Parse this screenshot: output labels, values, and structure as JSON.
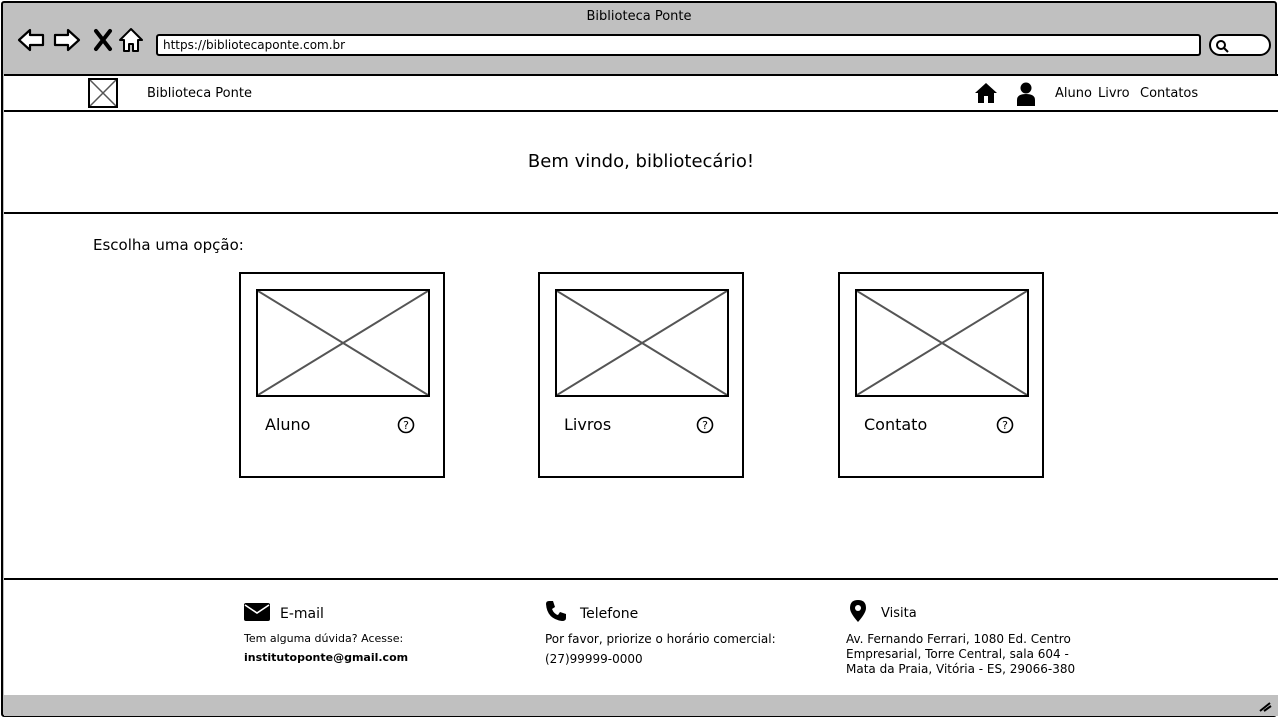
{
  "window": {
    "title": "Biblioteca Ponte"
  },
  "browser": {
    "url": "https://bibliotecaponte.com.br",
    "nav_icons": [
      "back-arrow-icon",
      "forward-arrow-icon",
      "stop-x-icon",
      "home-outline-icon"
    ],
    "search_icon": "magnifier-icon"
  },
  "header": {
    "brand": "Biblioteca Ponte",
    "icons": [
      "home-icon",
      "user-icon"
    ],
    "links": [
      "Aluno",
      "Livro",
      "Contatos"
    ]
  },
  "hero": {
    "title": "Bem vindo, bibliotecário!"
  },
  "options": {
    "prompt": "Escolha uma opção:",
    "cards": [
      {
        "label": "Aluno"
      },
      {
        "label": "Livros"
      },
      {
        "label": "Contato"
      }
    ]
  },
  "footer": {
    "email": {
      "title": "E-mail",
      "line1": "Tem alguma dúvida? Acesse:",
      "line2": "institutoponte@gmail.com"
    },
    "phone": {
      "title": "Telefone",
      "line1": "Por favor, priorize o horário comercial:",
      "line2": "(27)99999-0000"
    },
    "visit": {
      "title": "Visita",
      "address": "Av. Fernando Ferrari, 1080 Ed. Centro Empresarial, Torre Central, sala 604 - Mata da Praia, Vitória - ES, 29066-380"
    }
  }
}
